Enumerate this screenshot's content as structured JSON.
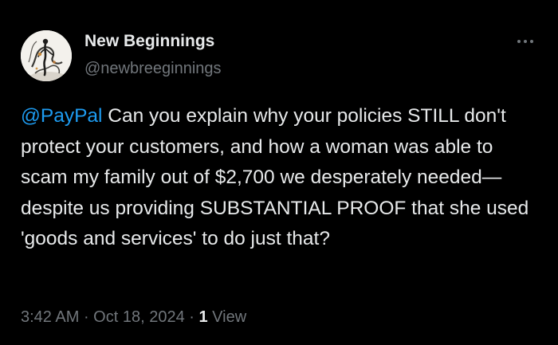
{
  "author": {
    "display_name": "New Beginnings",
    "handle": "@newbreeginnings"
  },
  "post": {
    "mention": "@PayPal",
    "text": " Can you explain why your policies STILL don't protect your customers, and how a woman was able to scam my family out of $2,700 we desperately needed—despite us providing SUBSTANTIAL PROOF that she used 'goods and services' to do just that?",
    "time": "3:42 AM",
    "date": "Oct 18, 2024",
    "separator": " · ",
    "view_count": "1",
    "view_label": " View"
  },
  "colors": {
    "background": "#000000",
    "primary_text": "#e7e9ea",
    "secondary_text": "#71767b",
    "link": "#1d9bf0"
  },
  "icons": {
    "more": "more-horizontal-icon"
  }
}
